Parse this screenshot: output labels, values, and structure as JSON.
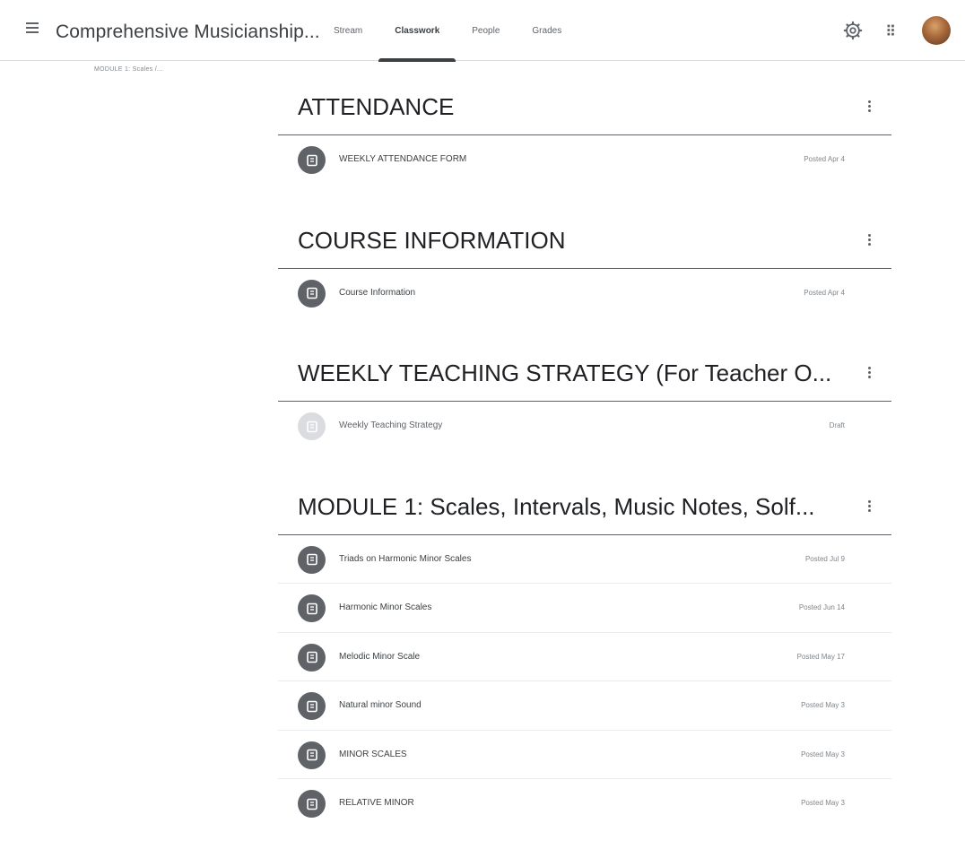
{
  "header": {
    "menu_icon": "hamburger-menu-icon",
    "title": "Comprehensive Musicianship...",
    "tabs": [
      {
        "label": "Stream",
        "active": false
      },
      {
        "label": "Classwork",
        "active": true
      },
      {
        "label": "People",
        "active": false
      },
      {
        "label": "Grades",
        "active": false
      }
    ],
    "icons": [
      "settings-gear-icon",
      "google-apps-icon",
      "user-avatar"
    ]
  },
  "breadcrumb": "MODULE 1: Scales /...",
  "colors": {
    "accent": "#3c4043",
    "assignment_icon": "#5f6368",
    "draft_icon": "#dadce0",
    "divider": "#5f6368"
  },
  "topics": [
    {
      "title": "ATTENDANCE",
      "items": [
        {
          "title": "WEEKLY ATTENDANCE FORM",
          "status": "Posted Apr 4",
          "draft": false
        }
      ]
    },
    {
      "title": "COURSE INFORMATION",
      "items": [
        {
          "title": "Course Information",
          "status": "Posted Apr 4",
          "draft": false
        }
      ]
    },
    {
      "title": "WEEKLY TEACHING STRATEGY (For Teacher O...",
      "items": [
        {
          "title": "Weekly Teaching Strategy",
          "status": "Draft",
          "draft": true
        }
      ]
    },
    {
      "title": "MODULE 1: Scales, Intervals, Music Notes, Solf...",
      "items": [
        {
          "title": "Triads on Harmonic Minor Scales",
          "status": "Posted Jul 9",
          "draft": false
        },
        {
          "title": "Harmonic Minor Scales",
          "status": "Posted Jun 14",
          "draft": false
        },
        {
          "title": "Melodic Minor Scale",
          "status": "Posted May 17",
          "draft": false
        },
        {
          "title": "Natural minor Sound",
          "status": "Posted May 3",
          "draft": false
        },
        {
          "title": "MINOR SCALES",
          "status": "Posted May 3",
          "draft": false
        },
        {
          "title": "RELATIVE MINOR",
          "status": "Posted May 3",
          "draft": false
        }
      ]
    }
  ]
}
